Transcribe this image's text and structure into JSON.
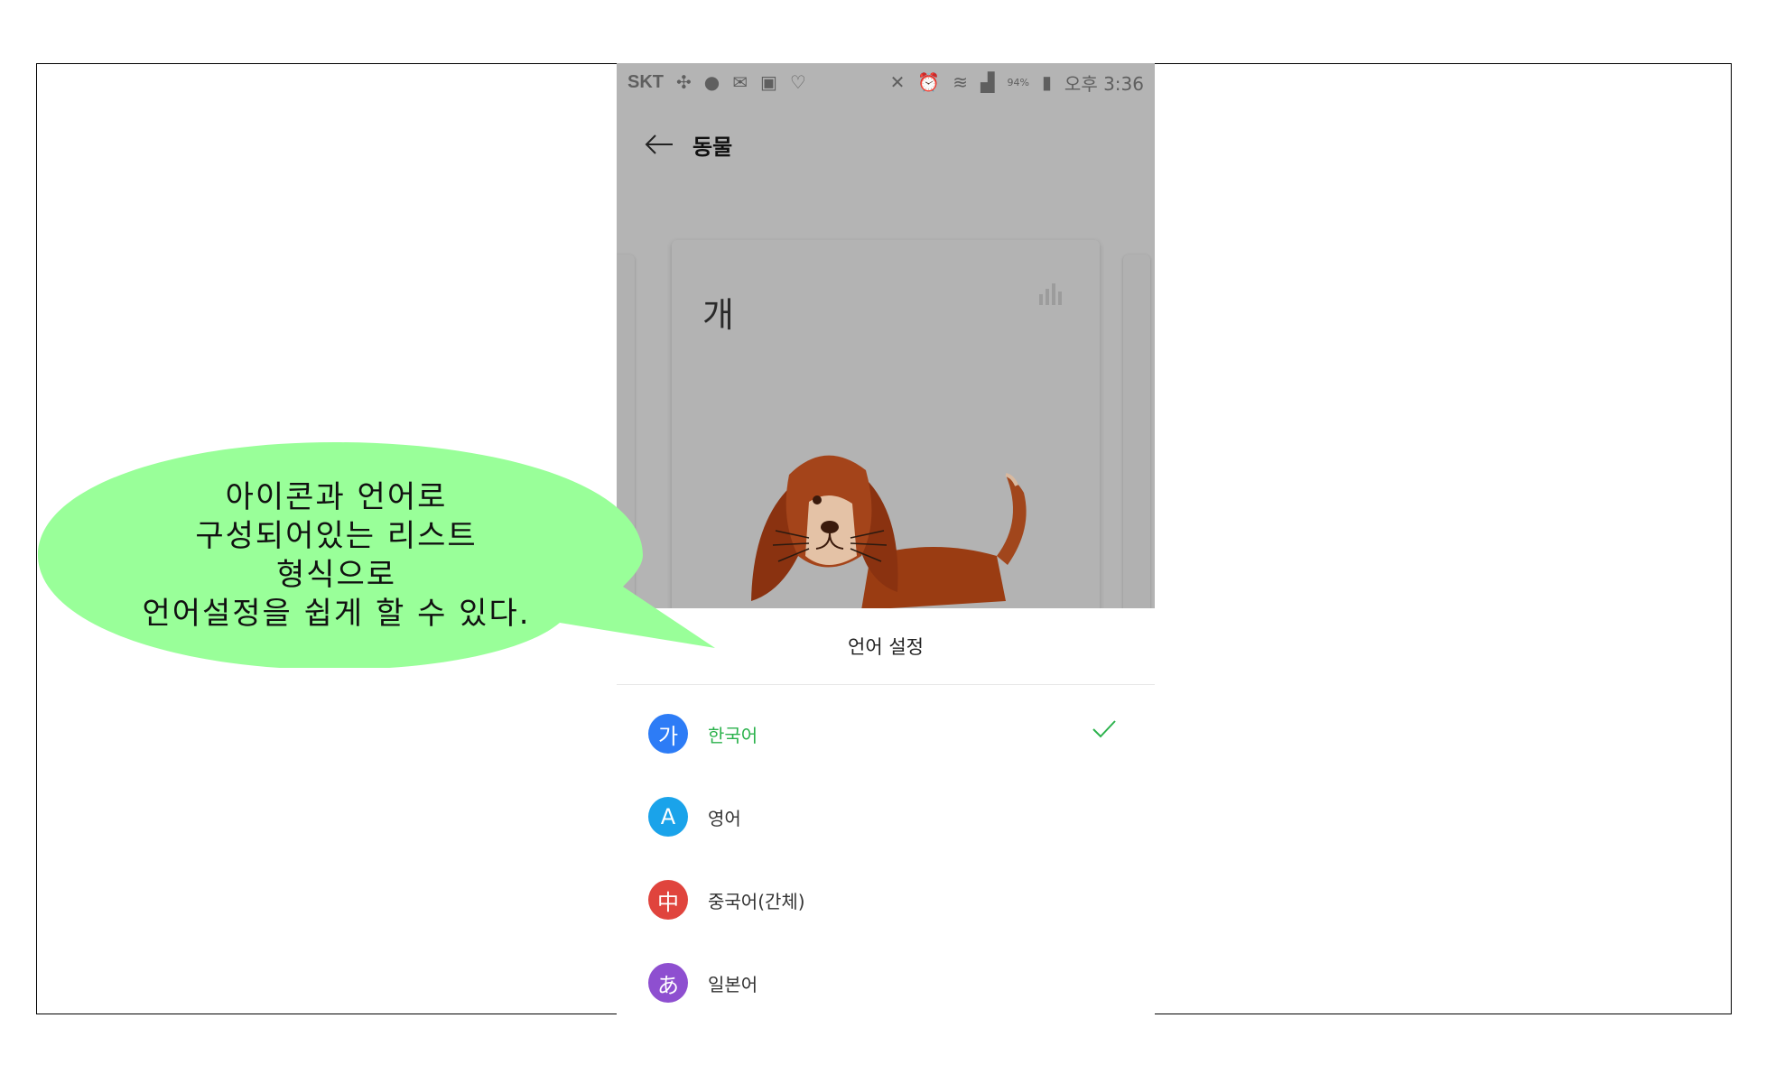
{
  "statusbar": {
    "carrier": "SKT",
    "battery_percent": "94%",
    "time": "오후 3:36"
  },
  "appbar": {
    "title": "동물"
  },
  "card": {
    "word": "개"
  },
  "sheet": {
    "title": "언어 설정",
    "languages": [
      {
        "badge": "가",
        "label": "한국어",
        "selected": true,
        "color": "#2d7cf6"
      },
      {
        "badge": "A",
        "label": "영어",
        "selected": false,
        "color": "#1aa3ea"
      },
      {
        "badge": "中",
        "label": "중국어(간체)",
        "selected": false,
        "color": "#e0443d"
      },
      {
        "badge": "あ",
        "label": "일본어",
        "selected": false,
        "color": "#8e4fd0"
      }
    ]
  },
  "callout": {
    "lines": [
      "아이콘과 언어로",
      "구성되어있는 리스트",
      "형식으로",
      "언어설정을 쉽게 할 수 있다."
    ],
    "color": "#99ff99"
  },
  "colors": {
    "selected_text": "#2bb24c",
    "overlay_gray": "#b4b4b4"
  }
}
